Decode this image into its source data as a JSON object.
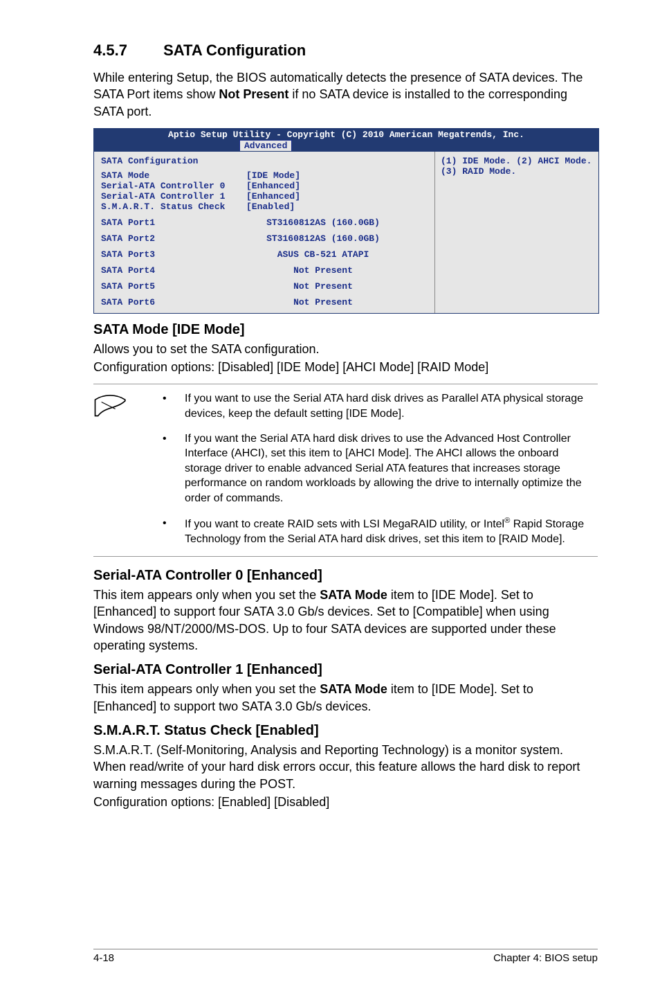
{
  "section": {
    "number": "4.5.7",
    "title": "SATA Configuration"
  },
  "intro": "While entering Setup, the BIOS automatically detects the presence of SATA devices. The SATA Port items show Not Present if no SATA device is installed to the corresponding SATA port.",
  "intro_pre": "While entering Setup, the BIOS automatically detects the presence of SATA devices. The SATA Port items show ",
  "intro_bold": "Not Present",
  "intro_post": " if no SATA device is installed to the corresponding SATA port.",
  "bios": {
    "title": "Aptio Setup Utility - Copyright (C) 2010 American Megatrends, Inc.",
    "tab": "Advanced",
    "left_title": "SATA Configuration",
    "settings": [
      {
        "k": "SATA Mode",
        "v": "[IDE Mode]"
      },
      {
        "k": "Serial-ATA Controller 0",
        "v": "[Enhanced]"
      },
      {
        "k": "Serial-ATA Controller 1",
        "v": "[Enhanced]"
      },
      {
        "k": "S.M.A.R.T. Status Check",
        "v": "[Enabled]"
      }
    ],
    "ports": [
      {
        "k": "SATA Port1",
        "v": "ST3160812AS (160.0GB)"
      },
      {
        "k": "SATA Port2",
        "v": "ST3160812AS (160.0GB)"
      },
      {
        "k": "SATA Port3",
        "v": "ASUS CB-521 ATAPI"
      },
      {
        "k": "SATA Port4",
        "v": "Not Present"
      },
      {
        "k": "SATA Port5",
        "v": "Not Present"
      },
      {
        "k": "SATA Port6",
        "v": "Not Present"
      }
    ],
    "help1": "(1) IDE Mode. (2) AHCI Mode.",
    "help2": "(3) RAID Mode."
  },
  "sub1": {
    "heading": "SATA Mode [IDE Mode]",
    "p1": "Allows you to set the SATA configuration.",
    "p2": "Configuration options: [Disabled] [IDE Mode] [AHCI Mode] [RAID Mode]"
  },
  "notes": {
    "b1": "If you want to use the Serial ATA hard disk drives as Parallel ATA physical storage devices, keep the default setting [IDE Mode].",
    "b2": "If you want the Serial ATA hard disk drives to use the Advanced Host Controller Interface (AHCI), set this item to [AHCI Mode]. The AHCI allows the onboard storage driver to enable advanced Serial ATA features that increases storage performance on random workloads by allowing the drive to internally optimize the order of commands.",
    "b3_pre": "If you want to create RAID sets with LSI MegaRAID utility, or Intel",
    "b3_sup": "®",
    "b3_post": " Rapid Storage Technology from the Serial ATA hard disk drives, set this item to [RAID Mode]."
  },
  "sub2": {
    "heading": "Serial-ATA Controller 0 [Enhanced]",
    "p_pre": "This item appears only when you set the ",
    "p_bold": "SATA Mode",
    "p_post": " item to [IDE Mode]. Set to [Enhanced] to support four SATA 3.0 Gb/s devices. Set to [Compatible] when using Windows 98/NT/2000/MS-DOS. Up to four SATA devices are supported under these operating systems."
  },
  "sub3": {
    "heading": "Serial-ATA Controller 1 [Enhanced]",
    "p_pre": "This item appears only when you set the ",
    "p_bold": "SATA Mode",
    "p_post": " item to [IDE Mode]. Set to [Enhanced] to support two SATA 3.0 Gb/s devices."
  },
  "sub4": {
    "heading": "S.M.A.R.T. Status Check [Enabled]",
    "p1": "S.M.A.R.T. (Self-Monitoring, Analysis and Reporting Technology) is a monitor system. When read/write of your hard disk errors occur, this feature allows the hard disk to report warning messages during the POST.",
    "p2": "Configuration options: [Enabled] [Disabled]"
  },
  "footer": {
    "left": "4-18",
    "right": "Chapter 4: BIOS setup"
  }
}
